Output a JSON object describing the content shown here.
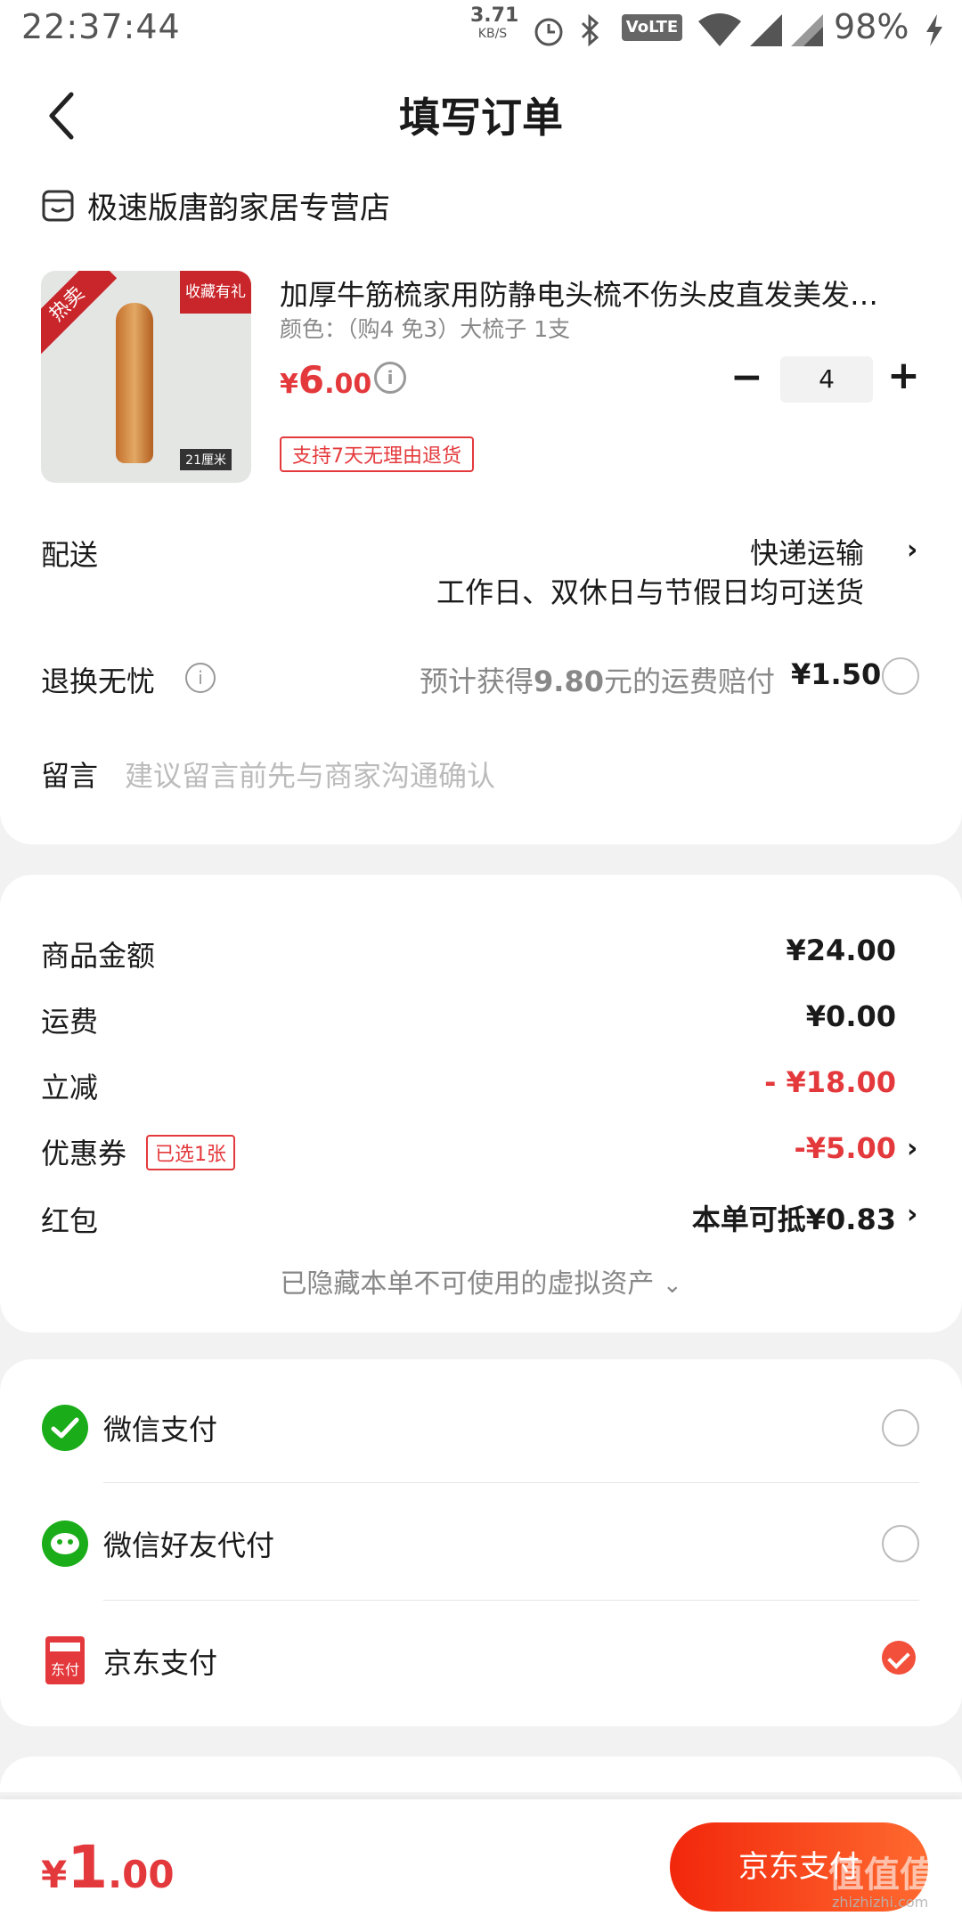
{
  "status_bar": {
    "time": "22:37:44",
    "net_speed": "3.71",
    "net_unit": "KB/S",
    "volte": "VoLTE",
    "battery": "98%",
    "icons": [
      "alarm-icon",
      "bluetooth-icon",
      "wifi-icon",
      "signal-icon",
      "signal-icon-2",
      "charging-icon"
    ]
  },
  "header": {
    "title": "填写订单",
    "back_icon": "back-chevron-icon"
  },
  "store": {
    "name": "极速版唐韵家居专营店",
    "icon": "store-icon"
  },
  "product": {
    "title": "加厚牛筋梳家用防静电头梳不伤头皮直发美发…",
    "spec": "颜色：（购4 免3）大梳子 1支",
    "price_symbol": "¥",
    "price_int": "6",
    "price_dec": ".00",
    "quantity": "4",
    "return_policy": "支持7天无理由退货",
    "image_badges": {
      "hot": "热卖",
      "gift": "收藏有礼",
      "size": "21厘米"
    }
  },
  "delivery": {
    "label": "配送",
    "method": "快递运输",
    "note": "工作日、双休日与节假日均可送货"
  },
  "return_insurance": {
    "label": "退换无忧",
    "desc_prefix": "预计获得",
    "desc_amount": "9.80",
    "desc_suffix": "元的运费赔付",
    "price": "¥1.50"
  },
  "message": {
    "label": "留言",
    "placeholder": "建议留言前先与商家沟通确认"
  },
  "summary": {
    "goods_label": "商品金额",
    "goods_value": "¥24.00",
    "shipping_label": "运费",
    "shipping_value": "¥0.00",
    "discount_label": "立减",
    "discount_value": "- ¥18.00",
    "coupon_label": "优惠券",
    "coupon_badge": "已选1张",
    "coupon_value": "-¥5.00",
    "redpacket_label": "红包",
    "redpacket_value": "本单可抵¥0.83",
    "hidden_assets": "已隐藏本单不可使用的虚拟资产"
  },
  "payment": {
    "methods": [
      {
        "label": "微信支付",
        "icon": "wechat-pay-icon",
        "selected": false
      },
      {
        "label": "微信好友代付",
        "icon": "wechat-friend-pay-icon",
        "selected": false
      },
      {
        "label": "京东支付",
        "icon": "jd-pay-icon",
        "selected": true
      }
    ]
  },
  "bottom": {
    "price_symbol": "¥",
    "price_int": "1",
    "price_dec": ".00",
    "pay_button": "京东支付",
    "watermark": "值值值",
    "watermark_url": "zhizhizhi.com"
  },
  "colors": {
    "accent": "#e4393c",
    "button_start": "#f2270c",
    "button_end": "#ff6a2f",
    "wechat": "#1aad19",
    "check": "#f2503b"
  }
}
